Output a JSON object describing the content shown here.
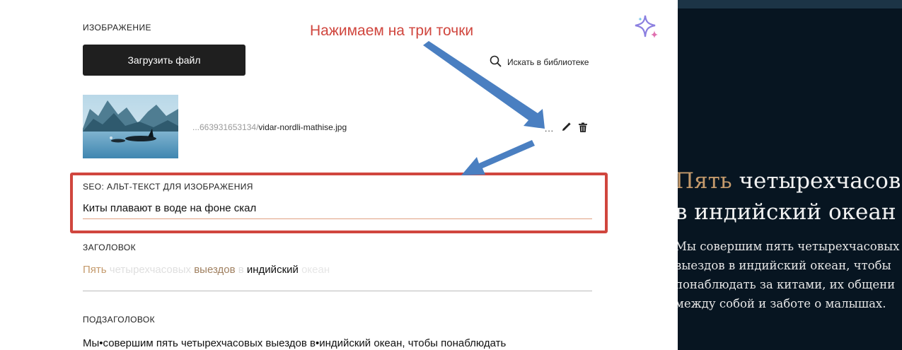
{
  "editor": {
    "image_section_label": "ИЗОБРАЖЕНИЕ",
    "upload_button_label": "Загрузить файл",
    "search_library_label": "Искать в библиотеке",
    "file_name_prefix": "...663931653134/",
    "file_name": "vidar-nordli-mathise.jpg",
    "more_actions_label": "...",
    "seo_label": "SEO: АЛЬТ-ТЕКСТ ДЛЯ ИЗОБРАЖЕНИЯ",
    "alt_text_value": "Киты плавают в воде на фоне скал",
    "heading_label": "ЗАГОЛОВОК",
    "heading_words": [
      "Пять",
      "четырехчасовых",
      "выездов",
      "в",
      "индийский",
      "океан"
    ],
    "subheading_label": "ПОДЗАГОЛОВОК",
    "subheading_value": "Мы•совершим пять четырехчасовых выездов в•индийский океан, чтобы понаблюдать"
  },
  "annotation": {
    "text": "Нажимаем на три точки"
  },
  "preview": {
    "title_accent": "Пять",
    "title_rest_1": " четырехчасов",
    "title_line_2": "в индийский океан",
    "subtitle_lines": [
      "Мы совершим пять четырехчасовых",
      "выездов в индийский океан, чтобы",
      "понаблюдать за китами, их общени",
      "между собой и заботе о малышах."
    ]
  },
  "colors": {
    "annotation_red": "#d0463e",
    "accent_gold": "#c49a6c",
    "preview_background": "#071521",
    "button_dark": "#1f1f1f"
  },
  "icons": [
    "search-icon",
    "pencil-icon",
    "trash-icon",
    "sparkle-icon"
  ]
}
